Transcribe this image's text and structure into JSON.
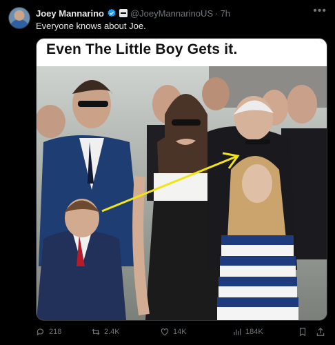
{
  "author": {
    "name": "Joey Mannarino",
    "handle": "@JoeyMannarinoUS",
    "time": "7h"
  },
  "tweet_text": "Everyone knows about Joe.",
  "image": {
    "caption": "Even The Little Boy Gets it."
  },
  "actions": {
    "replies": "218",
    "retweets": "2.4K",
    "likes": "14K",
    "views": "184K"
  },
  "colors": {
    "background": "#000000",
    "text": "#e7e9ea",
    "muted": "#71767b",
    "verified": "#1d9bf0",
    "arrow": "#f2e312"
  },
  "icons": [
    "verified-badge-icon",
    "affiliate-badge-icon",
    "more-icon",
    "reply-icon",
    "retweet-icon",
    "like-icon",
    "views-icon",
    "bookmark-icon",
    "share-icon"
  ]
}
